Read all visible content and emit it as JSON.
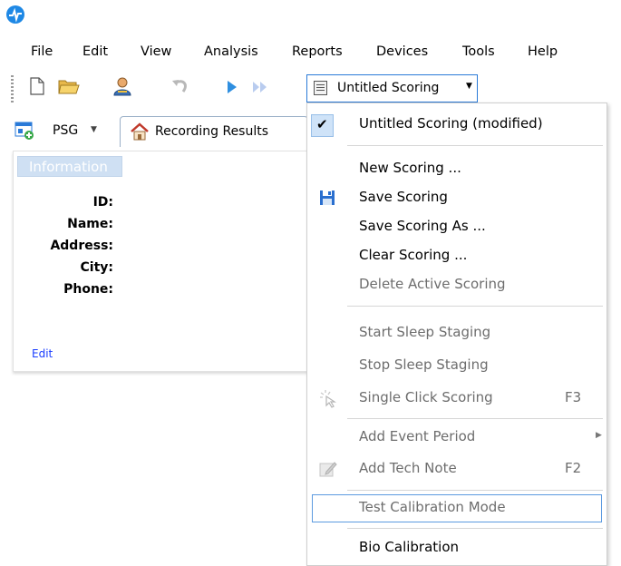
{
  "app": {
    "logo_icon": "app-logo-icon",
    "accent_color": "#1e88e5"
  },
  "menubar": [
    {
      "label": "File",
      "name": "menu-file"
    },
    {
      "label": "Edit",
      "name": "menu-edit"
    },
    {
      "label": "View",
      "name": "menu-view"
    },
    {
      "label": "Analysis",
      "name": "menu-analysis"
    },
    {
      "label": "Reports",
      "name": "menu-reports"
    },
    {
      "label": "Devices",
      "name": "menu-devices"
    },
    {
      "label": "Tools",
      "name": "menu-tools"
    },
    {
      "label": "Help",
      "name": "menu-help"
    }
  ],
  "toolbar": {
    "icons": [
      "new-document-icon",
      "open-folder-icon",
      "patient-icon",
      "undo-icon",
      "play-icon",
      "fast-forward-icon"
    ],
    "scoring_label": "Untitled Scoring",
    "scoring_icon": "scoring-list-icon"
  },
  "tabs": {
    "psg_label": "PSG",
    "recording_results_label": "Recording Results"
  },
  "info_panel": {
    "title": "Information",
    "fields": [
      "ID:",
      "Name:",
      "Address:",
      "City:",
      "Phone:"
    ],
    "edit_label": "Edit"
  },
  "scoring_menu": {
    "items": [
      {
        "label": "Untitled Scoring (modified)",
        "checked": true,
        "enabled": true
      },
      {
        "label": "New Scoring ...",
        "enabled": true
      },
      {
        "label": "Save Scoring",
        "enabled": true,
        "icon": "save-floppy-icon"
      },
      {
        "label": "Save Scoring As ...",
        "enabled": true
      },
      {
        "label": "Clear Scoring ...",
        "enabled": true
      },
      {
        "label": "Delete Active Scoring",
        "enabled": false
      },
      {
        "label": "Start Sleep Staging",
        "enabled": false
      },
      {
        "label": "Stop Sleep Staging",
        "enabled": false
      },
      {
        "label": "Single Click Scoring",
        "enabled": false,
        "shortcut": "F3",
        "icon": "pointer-click-icon"
      },
      {
        "label": "Add Event Period",
        "enabled": false,
        "submenu": true
      },
      {
        "label": "Add Tech Note",
        "enabled": false,
        "shortcut": "F2",
        "icon": "note-pencil-icon"
      },
      {
        "label": "Test Calibration Mode",
        "enabled": false,
        "highlighted": true
      },
      {
        "label": "Bio Calibration",
        "enabled": true
      }
    ]
  }
}
